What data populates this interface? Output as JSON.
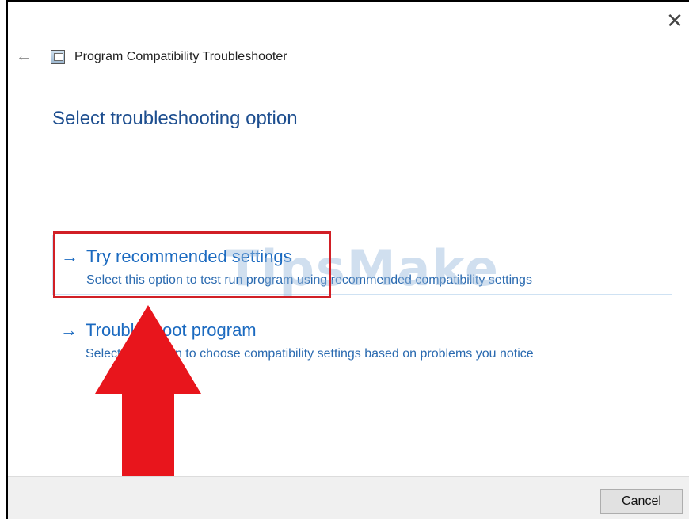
{
  "window": {
    "title": "Program Compatibility Troubleshooter",
    "close_glyph": "✕",
    "back_glyph": "←"
  },
  "heading": "Select troubleshooting option",
  "options": [
    {
      "arrow": "→",
      "title": "Try recommended settings",
      "description": "Select this option to test run program using recommended compatibility settings"
    },
    {
      "arrow": "→",
      "title": "Troubleshoot program",
      "description": "Select this option to choose compatibility settings based on problems you notice"
    }
  ],
  "watermark": "TipsMake",
  "footer": {
    "cancel_label": "Cancel"
  },
  "colors": {
    "heading": "#1d4e8f",
    "option_link": "#1b6ac0",
    "highlight": "#d11f26",
    "arrow": "#e8151c"
  },
  "icons": {
    "back": "back-arrow-icon",
    "close": "close-icon",
    "app": "troubleshooter-app-icon",
    "option": "right-arrow-icon"
  }
}
